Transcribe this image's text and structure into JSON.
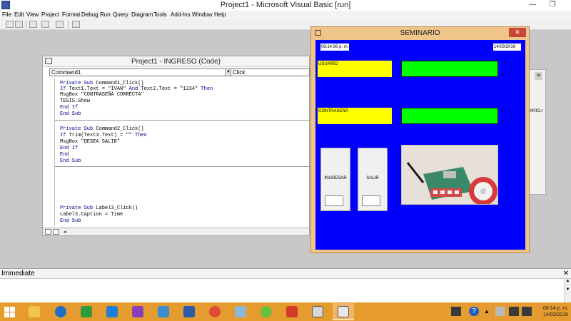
{
  "ide": {
    "title": "Project1 - Microsoft Visual Basic [run]",
    "menu": [
      "File",
      "Edit",
      "View",
      "Project",
      "Format",
      "Debug",
      "Run",
      "Query",
      "Diagram",
      "Tools",
      "Add-Ins",
      "Window",
      "Help"
    ]
  },
  "code_window": {
    "title": "Project1 - INGRESO (Code)",
    "object_combo": "Command1",
    "procedure_combo": "Click",
    "lines": [
      "Private Sub Command1_Click()",
      "If Text1.Text = \"IVAN\" And Text2.Text = \"1234\" Then",
      "MsgBox \"CONTRASEÑA CORRECTA\"",
      "TESIS.Show",
      "End If",
      "End Sub",
      "Private Sub Command2_Click()",
      "If Trim(Text3.Text) = \"\" Then",
      "MsgBox \"DESEA SALIR\"",
      "End If",
      "End",
      "End Sub",
      "Private Sub Label3_Click()",
      "Label3.Caption = Time",
      "End Sub"
    ]
  },
  "form": {
    "title": "SEMINARIO",
    "time_label": "08:14:36 p. m.",
    "date_label": "14/03/2016",
    "user_label": "USUARIO",
    "password_label": "CONTRASEÑA",
    "login_button": "INGRESAR",
    "exit_button": "SALIR"
  },
  "side_window": {
    "text": "ARIO.r"
  },
  "immediate": {
    "title": "Immediate"
  },
  "taskbar": {
    "clock_time": "08:14 p. m.",
    "clock_date": "14/03/2016",
    "accent": "#e59b2e"
  }
}
